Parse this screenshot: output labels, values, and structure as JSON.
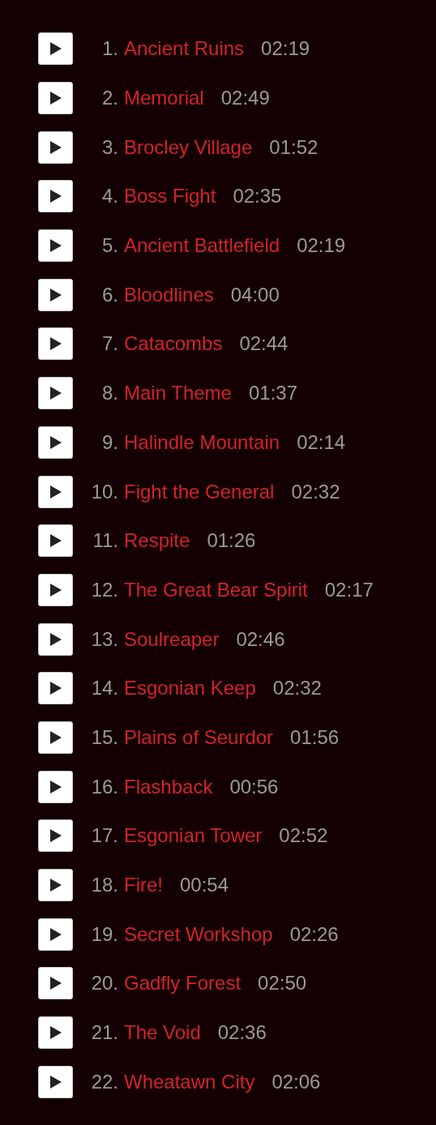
{
  "tracks": [
    {
      "number": "1.",
      "title": "Ancient Ruins",
      "duration": "02:19"
    },
    {
      "number": "2.",
      "title": "Memorial",
      "duration": "02:49"
    },
    {
      "number": "3.",
      "title": "Brocley Village",
      "duration": "01:52"
    },
    {
      "number": "4.",
      "title": "Boss Fight",
      "duration": "02:35"
    },
    {
      "number": "5.",
      "title": "Ancient Battlefield",
      "duration": "02:19"
    },
    {
      "number": "6.",
      "title": "Bloodlines",
      "duration": "04:00"
    },
    {
      "number": "7.",
      "title": "Catacombs",
      "duration": "02:44"
    },
    {
      "number": "8.",
      "title": "Main Theme",
      "duration": "01:37"
    },
    {
      "number": "9.",
      "title": "Halindle Mountain",
      "duration": "02:14"
    },
    {
      "number": "10.",
      "title": "Fight the General",
      "duration": "02:32"
    },
    {
      "number": "11.",
      "title": "Respite",
      "duration": "01:26"
    },
    {
      "number": "12.",
      "title": "The Great Bear Spirit",
      "duration": "02:17"
    },
    {
      "number": "13.",
      "title": "Soulreaper",
      "duration": "02:46"
    },
    {
      "number": "14.",
      "title": "Esgonian Keep",
      "duration": "02:32"
    },
    {
      "number": "15.",
      "title": "Plains of Seurdor",
      "duration": "01:56"
    },
    {
      "number": "16.",
      "title": "Flashback",
      "duration": "00:56"
    },
    {
      "number": "17.",
      "title": "Esgonian Tower",
      "duration": "02:52"
    },
    {
      "number": "18.",
      "title": "Fire!",
      "duration": "00:54"
    },
    {
      "number": "19.",
      "title": "Secret Workshop",
      "duration": "02:26"
    },
    {
      "number": "20.",
      "title": "Gadfly Forest",
      "duration": "02:50"
    },
    {
      "number": "21.",
      "title": "The Void",
      "duration": "02:36"
    },
    {
      "number": "22.",
      "title": "Wheatawn City",
      "duration": "02:06"
    }
  ]
}
